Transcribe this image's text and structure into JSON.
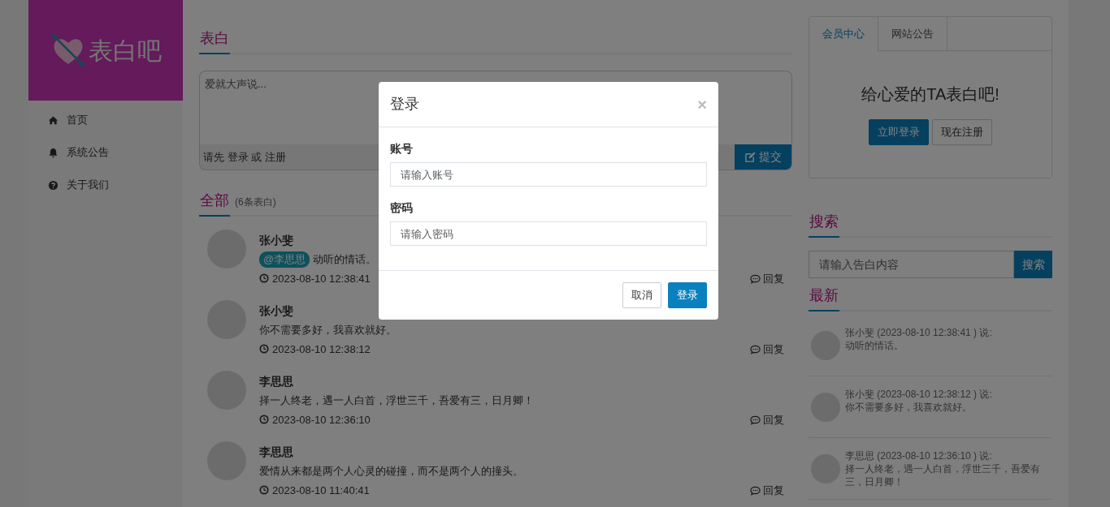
{
  "sidebar": {
    "logo": "表白吧",
    "items": [
      {
        "label": "首页"
      },
      {
        "label": "系统公告"
      },
      {
        "label": "关于我们"
      }
    ]
  },
  "post_form": {
    "title": "表白",
    "placeholder": "爱就大声说...",
    "prompt_prefix": "请先",
    "login_link": "登录",
    "prompt_or": "或",
    "register_link": "注册",
    "submit": "提交"
  },
  "feed": {
    "title": "全部",
    "count": "(6条表白)",
    "posts": [
      {
        "author": "张小斐",
        "mention": "@李思思",
        "text": "动听的情话。",
        "time": "2023-08-10 12:38:41",
        "reply": "回复"
      },
      {
        "author": "张小斐",
        "text": "你不需要多好，我喜欢就好。",
        "time": "2023-08-10 12:38:12",
        "reply": "回复"
      },
      {
        "author": "李思思",
        "text": "择一人终老，遇一人白首，浮世三千，吾爱有三，日月卿！",
        "time": "2023-08-10 12:36:10",
        "reply": "回复"
      },
      {
        "author": "李思思",
        "text": "爱情从来都是两个人心灵的碰撞，而不是两个人的撞头。",
        "time": "2023-08-10 11:40:41",
        "reply": "回复"
      }
    ]
  },
  "member_panel": {
    "tabs": [
      {
        "label": "会员中心",
        "selected": true
      },
      {
        "label": "网站公告",
        "selected": false
      }
    ],
    "welcome": "给心爱的TA表白吧!",
    "login_button": "立即登录",
    "register_button": "现在注册"
  },
  "search": {
    "title": "搜索",
    "placeholder": "请输入告白内容",
    "button": "搜索"
  },
  "latest": {
    "title": "最新",
    "items": [
      {
        "header": "张小斐 (2023-08-10 12:38:41 ) 说:",
        "text": "动听的情话。"
      },
      {
        "header": "张小斐 (2023-08-10 12:38:12 ) 说:",
        "text": "你不需要多好，我喜欢就好。"
      },
      {
        "header": "李思思 (2023-08-10 12:36:10 ) 说:",
        "text": "择一人终老，遇一人白首，浮世三千，吾爱有三，日月卿！"
      }
    ]
  },
  "login_modal": {
    "title": "登录",
    "close": "×",
    "fields": [
      {
        "label": "账号",
        "placeholder": "请输入账号"
      },
      {
        "label": "密码",
        "placeholder": "请输入密码"
      }
    ],
    "cancel": "取消",
    "submit": "登录"
  }
}
